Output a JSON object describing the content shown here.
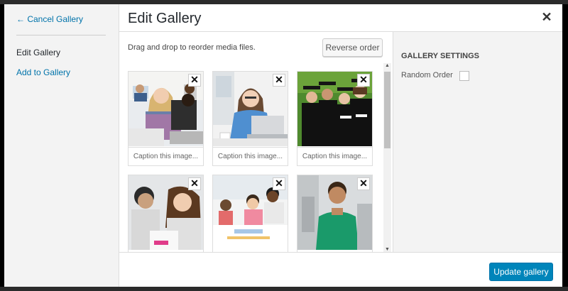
{
  "menu": {
    "cancel_label": "← Cancel Gallery",
    "edit_label": "Edit Gallery",
    "add_label": "Add to Gallery"
  },
  "header": {
    "title": "Edit Gallery",
    "close_glyph": "✕"
  },
  "main": {
    "instructions": "Drag and drop to reorder media files.",
    "reverse_label": "Reverse order",
    "remove_glyph": "✕",
    "images": [
      {
        "caption": "Caption this image...",
        "subject": "students-laptop"
      },
      {
        "caption": "Caption this image...",
        "subject": "woman-laptop"
      },
      {
        "caption": "Caption this image...",
        "subject": "graduates"
      },
      {
        "caption": "",
        "subject": "students-studying"
      },
      {
        "caption": "",
        "subject": "classroom-table"
      },
      {
        "caption": "",
        "subject": "teen-boy"
      }
    ]
  },
  "settings": {
    "heading": "GALLERY SETTINGS",
    "random_order_label": "Random Order",
    "random_order_checked": false
  },
  "footer": {
    "update_label": "Update gallery"
  },
  "colors": {
    "accent": "#0085ba",
    "link": "#0073aa"
  }
}
